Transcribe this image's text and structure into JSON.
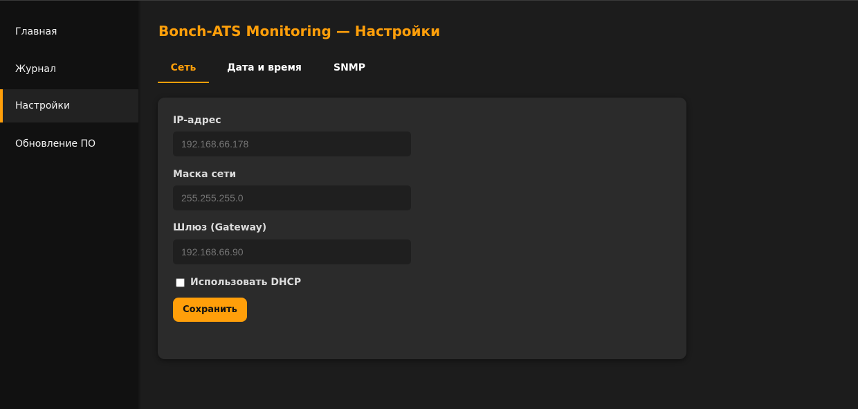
{
  "sidebar": {
    "items": [
      {
        "label": "Главная",
        "active": false
      },
      {
        "label": "Журнал",
        "active": false
      },
      {
        "label": "Настройки",
        "active": true
      },
      {
        "label": "Обновление ПО",
        "active": false
      }
    ]
  },
  "header": {
    "title": "Bonch-ATS Monitoring — Настройки"
  },
  "tabs": [
    {
      "label": "Сеть",
      "active": true
    },
    {
      "label": "Дата и время",
      "active": false
    },
    {
      "label": "SNMP",
      "active": false
    }
  ],
  "network_form": {
    "ip_label": "IP-адрес",
    "ip_placeholder": "192.168.66.178",
    "mask_label": "Маска сети",
    "mask_placeholder": "255.255.255.0",
    "gateway_label": "Шлюз (Gateway)",
    "gateway_placeholder": "192.168.66.90",
    "dhcp_label": "Использовать DHCP",
    "dhcp_checked": false,
    "save_label": "Сохранить"
  },
  "colors": {
    "accent": "#ff9f0a",
    "background": "#1c1c1c",
    "sidebar": "#111111",
    "panel": "#2b2b2b",
    "input": "#1f1f1f"
  }
}
